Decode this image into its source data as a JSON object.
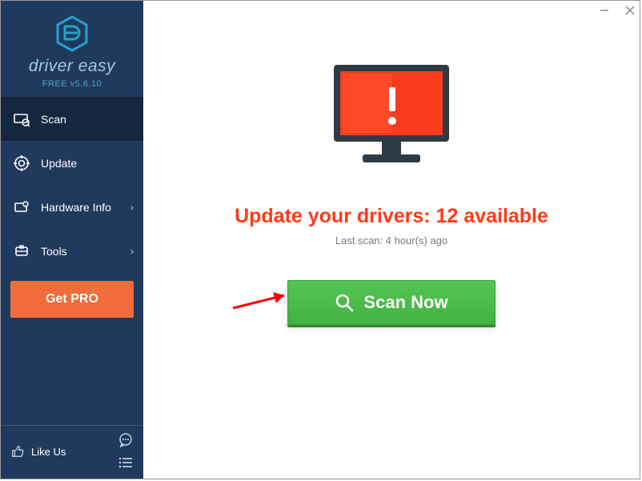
{
  "app": {
    "brand": "driver easy",
    "version": "FREE v5.6.10"
  },
  "sidebar": {
    "items": [
      {
        "label": "Scan"
      },
      {
        "label": "Update"
      },
      {
        "label": "Hardware Info"
      },
      {
        "label": "Tools"
      }
    ],
    "get_pro_label": "Get PRO",
    "like_us_label": "Like Us"
  },
  "main": {
    "headline": "Update your drivers: 12 available",
    "subline": "Last scan: 4 hour(s) ago",
    "scan_button_label": "Scan Now"
  }
}
